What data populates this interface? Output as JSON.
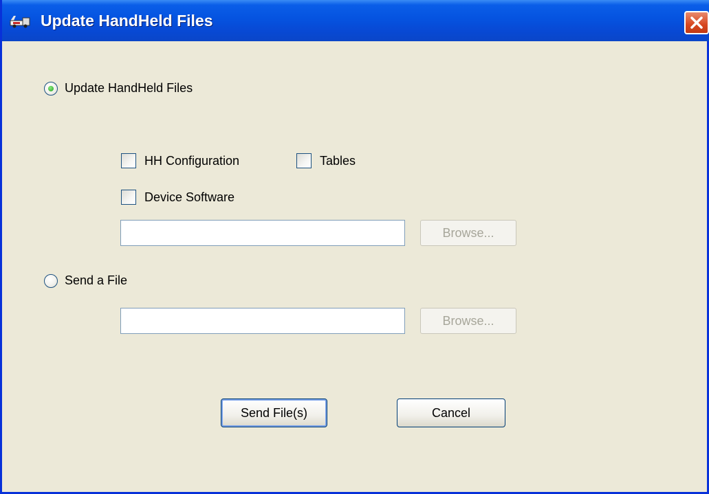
{
  "window": {
    "title": "Update HandHeld Files",
    "title_icon": "handheld-truck-icon",
    "close_icon": "close-icon",
    "colors": {
      "titlebar": "#0553e0",
      "close": "#d8471f",
      "background": "#ece9d8"
    }
  },
  "options": {
    "update_radio": {
      "label": "Update HandHeld Files",
      "checked": true
    },
    "checkboxes": [
      {
        "label": "HH Configuration",
        "checked": false
      },
      {
        "label": "Tables",
        "checked": false
      },
      {
        "label": "Device Software",
        "checked": false
      }
    ],
    "update_path": {
      "value": "",
      "placeholder": ""
    },
    "update_browse_label": "Browse...",
    "send_radio": {
      "label": "Send a File",
      "checked": false
    },
    "send_path": {
      "value": "",
      "placeholder": ""
    },
    "send_browse_label": "Browse..."
  },
  "buttons": {
    "send_label": "Send File(s)",
    "cancel_label": "Cancel"
  }
}
